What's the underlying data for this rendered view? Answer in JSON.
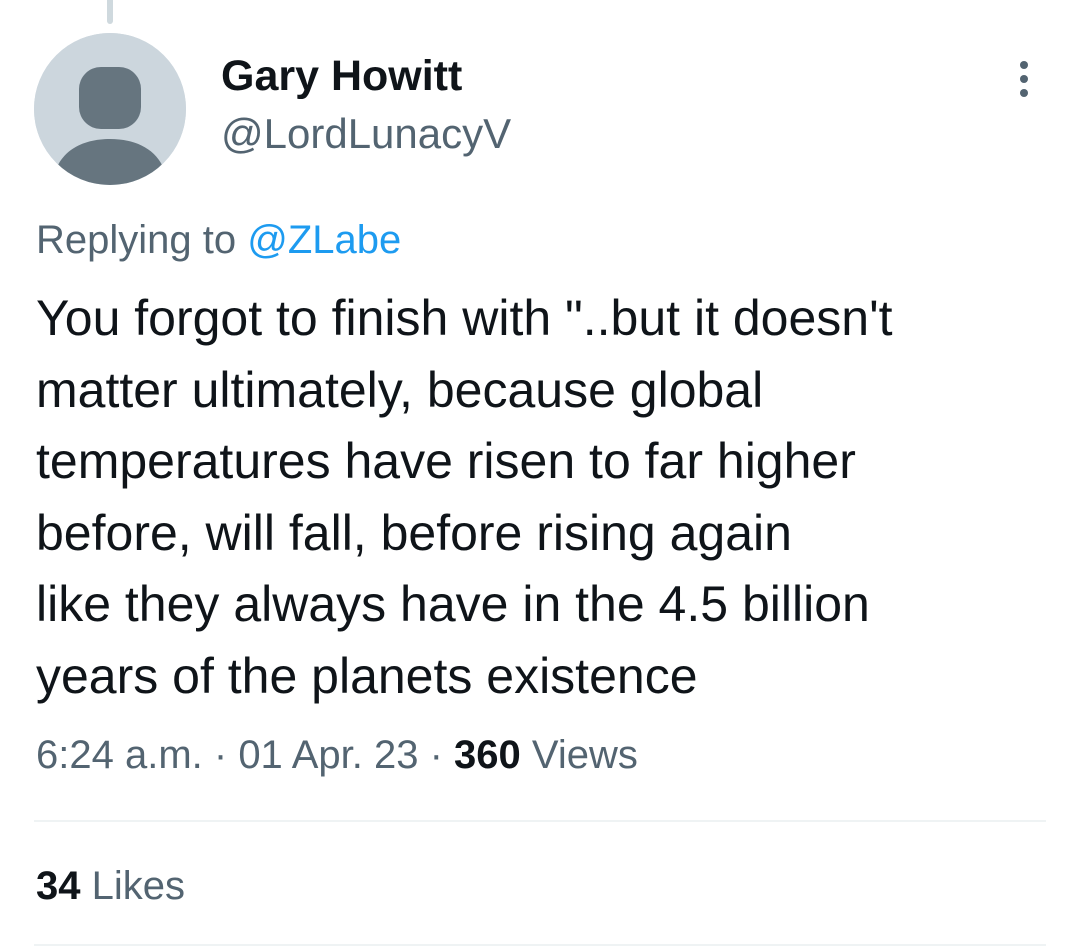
{
  "author": {
    "display_name": "Gary Howitt",
    "handle": "@LordLunacyV",
    "avatar_icon": "default-profile-avatar-icon"
  },
  "reply": {
    "prefix": "Replying to ",
    "mention": "@ZLabe"
  },
  "tweet": {
    "text": "You forgot to finish with \"..but it doesn't\nmatter  ultimately, because global\ntemperatures have risen to far higher\nbefore, will fall, before rising again\nlike they always have in the 4.5 billion\nyears of the planets existence"
  },
  "meta": {
    "time": "6:24 a.m.",
    "separator": " · ",
    "date": "01 Apr. 23",
    "views_count": "360",
    "views_label": " Views"
  },
  "engagement": {
    "likes_count": "34",
    "likes_label": " Likes"
  },
  "icons": {
    "more": "more-options-icon"
  },
  "colors": {
    "link": "#1d9bf0",
    "secondary_text": "#536471",
    "primary_text": "#0f1419",
    "avatar_bg": "#ccd6dd",
    "avatar_figure": "#66757f",
    "divider": "#eff3f4"
  }
}
